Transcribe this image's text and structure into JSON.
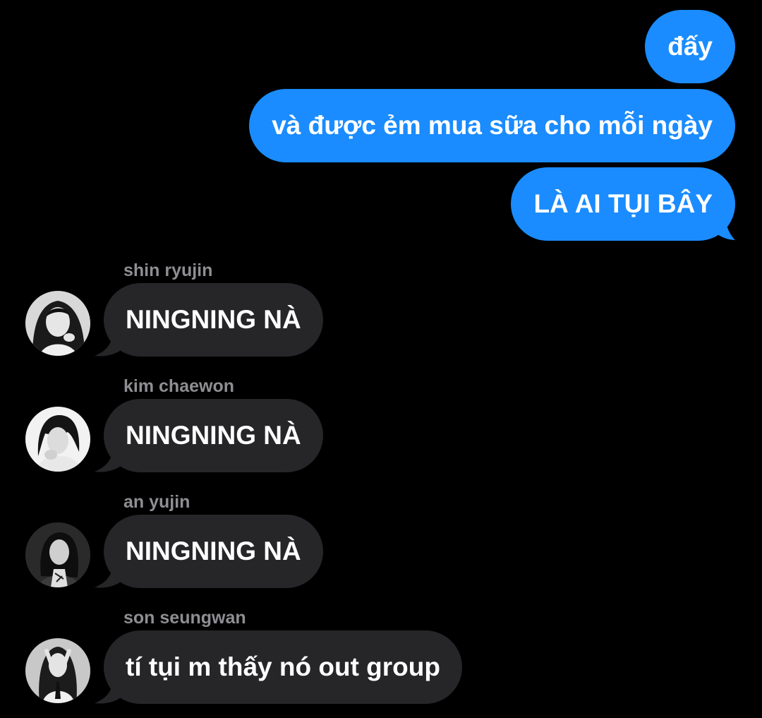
{
  "outgoing": [
    {
      "text": "đấy"
    },
    {
      "text": "và được ẻm mua sữa cho mỗi ngày"
    },
    {
      "text": "LÀ AI TỤI BÂY"
    }
  ],
  "incoming": [
    {
      "sender": "shin ryujin",
      "text": "NINGNING NÀ",
      "avatar": "avatar-photo"
    },
    {
      "sender": "kim chaewon",
      "text": "NINGNING NÀ",
      "avatar": "avatar-photo"
    },
    {
      "sender": "an yujin",
      "text": "NINGNING NÀ",
      "avatar": "avatar-photo"
    },
    {
      "sender": "son seungwan",
      "text": "tí tụi m thấy nó out group",
      "avatar": "avatar-photo"
    }
  ],
  "colors": {
    "background": "#000000",
    "outgoing_bubble": "#1a8cff",
    "incoming_bubble": "#262629",
    "sender_name": "#8e8e93",
    "message_text": "#ffffff"
  }
}
